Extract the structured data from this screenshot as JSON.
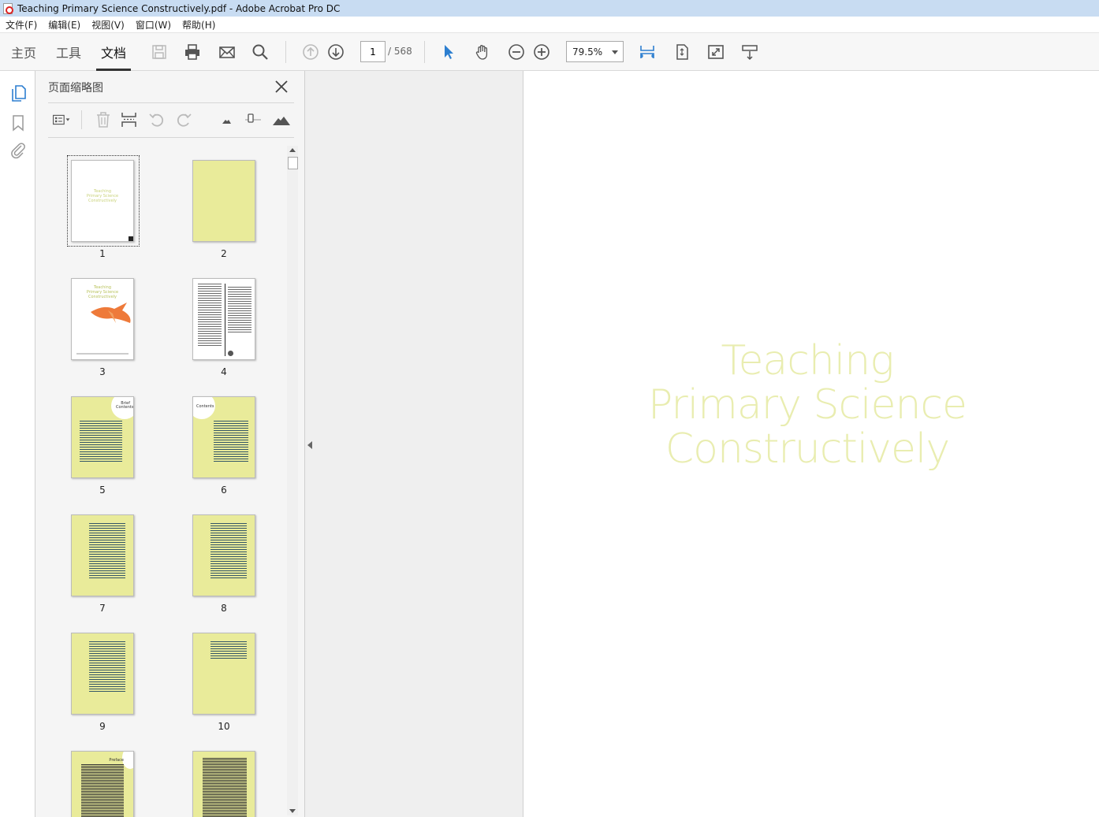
{
  "window": {
    "title": "Teaching Primary Science Constructively.pdf - Adobe Acrobat Pro DC"
  },
  "menu": [
    "文件(F)",
    "编辑(E)",
    "视图(V)",
    "窗口(W)",
    "帮助(H)"
  ],
  "tabs": [
    {
      "label": "主页"
    },
    {
      "label": "工具"
    },
    {
      "label": "文档"
    }
  ],
  "nav": {
    "current_page": "1",
    "total_pages": "/ 568"
  },
  "zoom": {
    "value": "79.5%"
  },
  "panel": {
    "title": "页面缩略图"
  },
  "thumbnails": [
    {
      "num": "1",
      "style": "white-cover"
    },
    {
      "num": "2",
      "style": "yellow-blank"
    },
    {
      "num": "3",
      "style": "white-bird"
    },
    {
      "num": "4",
      "style": "white-text"
    },
    {
      "num": "5",
      "style": "yellow-contents",
      "heading": "Brief Contents"
    },
    {
      "num": "6",
      "style": "yellow-contents",
      "heading": "Contents"
    },
    {
      "num": "7",
      "style": "yellow-contents"
    },
    {
      "num": "8",
      "style": "yellow-contents"
    },
    {
      "num": "9",
      "style": "yellow-contents"
    },
    {
      "num": "10",
      "style": "yellow-contents"
    },
    {
      "num": "",
      "style": "yellow-dense",
      "heading": "Preface"
    },
    {
      "num": "",
      "style": "yellow-dense"
    }
  ],
  "document": {
    "cover_lines": [
      "Teaching",
      "Primary Science",
      "Constructively"
    ],
    "cover_color": "#e9edb0"
  },
  "colors": {
    "accent": "#2d7fd0",
    "thumb_yellow": "#e9eb9a"
  }
}
